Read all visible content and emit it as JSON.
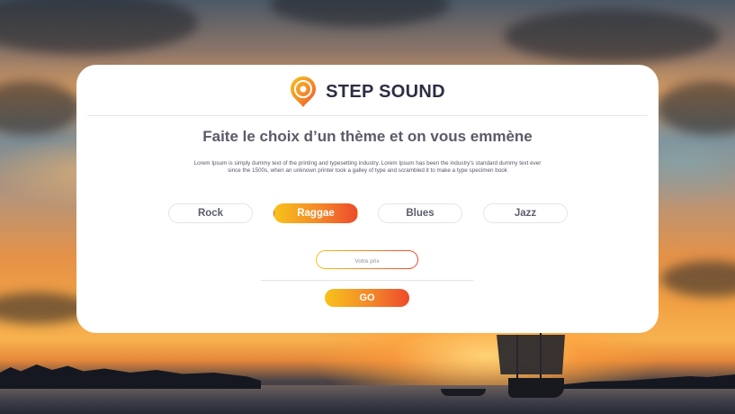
{
  "brand": {
    "name": "STEP SOUND",
    "colors": {
      "accent_start": "#f7c21b",
      "accent_mid": "#f3872a",
      "accent_end": "#ed4a2b",
      "text_dark": "#2d2e43"
    }
  },
  "hero": {
    "title": "Faite le choix d’un thème et on vous emmène",
    "description": "Lorem Ipsum is simply dummy text of the printing and typesetting industry. Lorem Ipsum has been the industry's standard dummy text ever since the 1500s, when an unknown printer took a galley of type and scrambled it to make a type specimen book"
  },
  "genres": [
    {
      "label": "Rock",
      "selected": false
    },
    {
      "label": "Raggae",
      "selected": true
    },
    {
      "label": "Blues",
      "selected": false
    },
    {
      "label": "Jazz",
      "selected": false
    }
  ],
  "price_input": {
    "placeholder": "Votre prix",
    "value": ""
  },
  "go_button": {
    "label": "GO"
  },
  "icons": {
    "logo": "music-disc-pin-icon"
  }
}
